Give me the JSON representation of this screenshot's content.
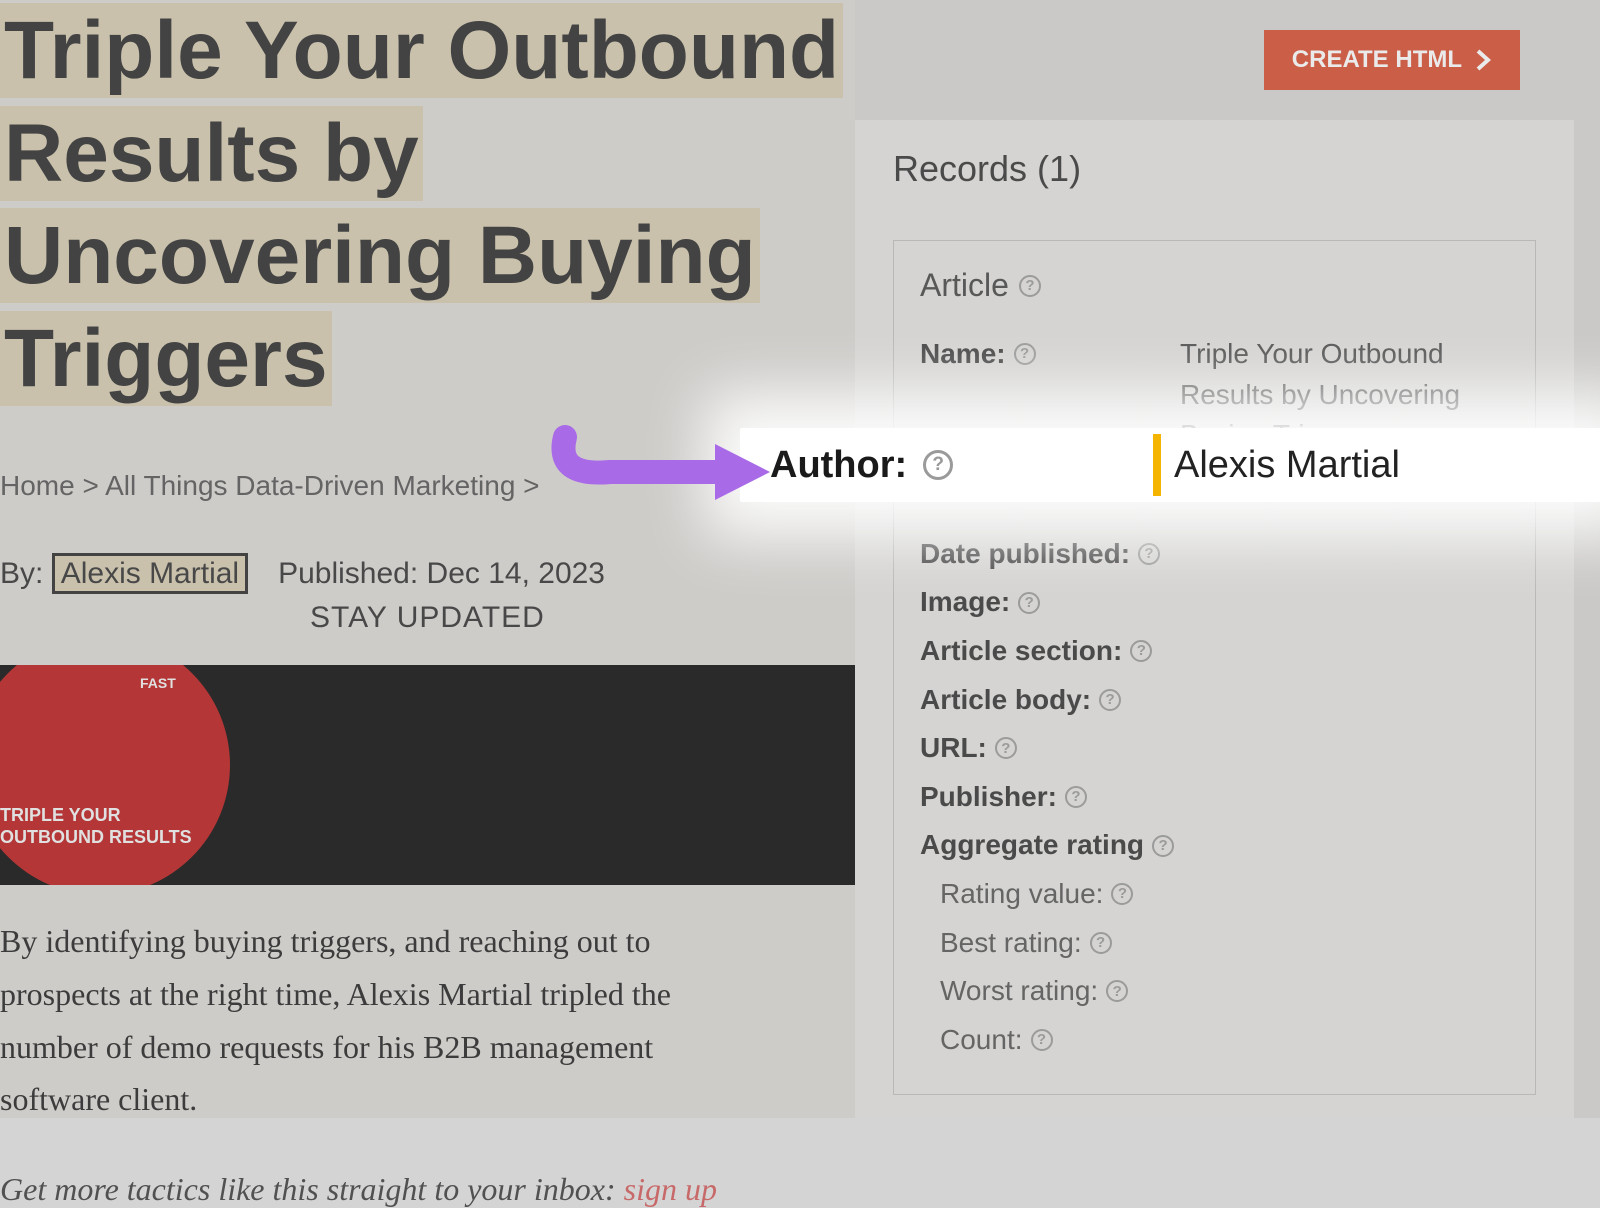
{
  "left": {
    "title": "Triple Your Outbound Results by Uncovering Buying Triggers",
    "breadcrumb": {
      "home": "Home",
      "category": "All Things Data-Driven Marketing"
    },
    "byline_prefix": "By:",
    "author": "Alexis Martial",
    "published_prefix": "Published:",
    "published_date": "Dec 14, 2023",
    "stay_updated": "STAY UPDATED",
    "hero_top": "FAST",
    "hero_bottom_l1": "TRIPLE YOUR",
    "hero_bottom_l2": "OUTBOUND RESULTS",
    "body": "By identifying buying triggers, and reaching out to prospects at the right time, Alexis Martial tripled the number of demo requests for his B2B management software client.",
    "cta_text": "Get more tactics like this straight to your inbox: ",
    "signup": "sign up"
  },
  "right": {
    "create_btn": "CREATE HTML",
    "records_heading": "Records (1)",
    "record_type": "Article",
    "fields": {
      "name_label": "Name:",
      "name_value": "Triple Your Outbound Results by Uncovering Buying Triggers",
      "author_label": "Author:",
      "author_value": "Alexis Martial",
      "date_published_label": "Date published:",
      "image_label": "Image:",
      "article_section_label": "Article section:",
      "article_body_label": "Article body:",
      "url_label": "URL:",
      "publisher_label": "Publisher:",
      "aggregate_rating_label": "Aggregate rating",
      "rating_value_label": "Rating value:",
      "best_rating_label": "Best rating:",
      "worst_rating_label": "Worst rating:",
      "count_label": "Count:"
    }
  }
}
